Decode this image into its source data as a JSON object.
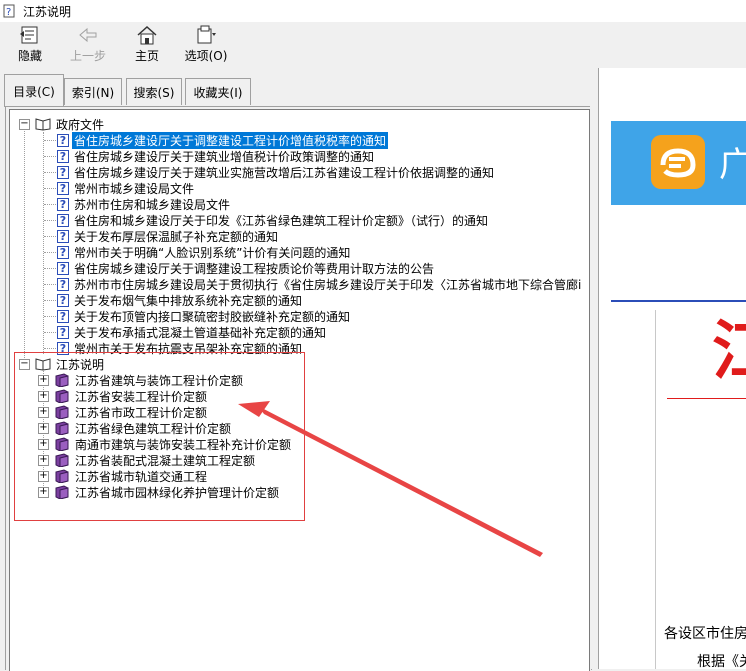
{
  "window": {
    "title": "江苏说明"
  },
  "toolbar": {
    "hide_label": "隐藏",
    "back_label": "上一步",
    "home_label": "主页",
    "options_label": "选项(O)"
  },
  "tabs": [
    {
      "label": "目录(C)"
    },
    {
      "label": "索引(N)"
    },
    {
      "label": "搜索(S)"
    },
    {
      "label": "收藏夹(I)"
    }
  ],
  "tree": {
    "group1": {
      "label": "政府文件",
      "items": [
        "省住房城乡建设厅关于调整建设工程计价增值税税率的通知",
        "省住房城乡建设厅关于建筑业增值税计价政策调整的通知",
        "省住房城乡建设厅关于建筑业实施营改增后江苏省建设工程计价依据调整的通知",
        "常州市城乡建设局文件",
        "苏州市住房和城乡建设局文件",
        "省住房和城乡建设厅关于印发《江苏省绿色建筑工程计价定额》（试行）的通知",
        "关于发布厚层保温腻子补充定额的通知",
        "常州市关于明确“人脸识别系统”计价有关问题的通知",
        "省住房城乡建设厅关于调整建设工程按质论价等费用计取方法的公告",
        "苏州市市住房城乡建设局关于贯彻执行《省住房城乡建设厅关于印发〈江苏省城市地下综合管廊i",
        "关于发布烟气集中排放系统补充定额的通知",
        "关于发布顶管内接口聚硫密封胶嵌缝补充定额的通知",
        "关于发布承插式混凝土管道基础补充定额的通知",
        "常州市关于发布抗震支吊架补充定额的通知"
      ]
    },
    "group2": {
      "label": "江苏说明",
      "items": [
        "江苏省建筑与装饰工程计价定额",
        "江苏省安装工程计价定额",
        "江苏省市政工程计价定额",
        "江苏省绿色建筑工程计价定额",
        "南通市建筑与装饰安装工程补充计价定额",
        "江苏省装配式混凝土建筑工程定额",
        "江苏省城市轨道交通工程",
        "江苏省城市园林绿化养护管理计价定额"
      ]
    }
  },
  "content": {
    "banner_text": "广",
    "red_title": "江",
    "line1": "各设区市住房",
    "line2": "根据《关"
  },
  "colors": {
    "selection": "#0078d7",
    "banner": "#3fa4e8",
    "annotation_red": "#e04040",
    "title_red": "#e01b1b"
  }
}
